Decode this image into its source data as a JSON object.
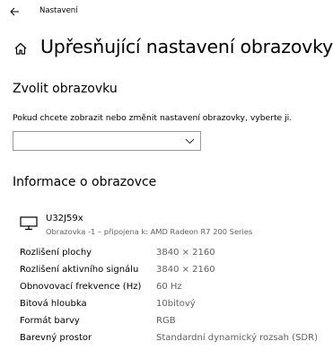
{
  "titlebar": {
    "app_title": "Nastavení",
    "back_icon": "back-arrow-icon"
  },
  "header": {
    "home_icon": "home-icon",
    "title": "Upřesňující nastavení obrazovky"
  },
  "choose_display": {
    "title": "Zvolit obrazovku",
    "description": "Pokud chcete zobrazit nebo změnit nastavení obrazovky, vyberte ji.",
    "selected_value": ""
  },
  "display_info": {
    "title": "Informace o obrazovce",
    "monitor_icon": "monitor-icon",
    "monitor_name": "U32J59x",
    "monitor_subtitle": "Obrazovka -1 – připojena k: AMD Radeon R7 200 Series",
    "rows": [
      {
        "label": "Rozlišení plochy",
        "value": "3840 × 2160"
      },
      {
        "label": "Rozlišení aktivního signálu",
        "value": "3840 × 2160"
      },
      {
        "label": "Obnovovací frekvence (Hz)",
        "value": "60 Hz"
      },
      {
        "label": "Bitová hloubka",
        "value": "10bitový"
      },
      {
        "label": "Formát barvy",
        "value": "RGB"
      },
      {
        "label": "Barevný prostor",
        "value": "Standardní dynamický rozsah (SDR)"
      }
    ]
  }
}
